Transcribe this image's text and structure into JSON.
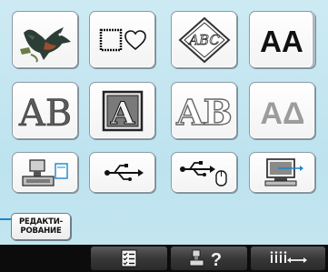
{
  "edit_button": {
    "line1": "РЕДАКТИ-",
    "line2": "РОВАНИЕ"
  },
  "grid": [
    {
      "name": "pattern-embroidery-icon"
    },
    {
      "name": "frame-shapes-icon"
    },
    {
      "name": "monogram-abc-icon",
      "text": "ABC"
    },
    {
      "name": "alphabet-font-icon",
      "text": "AA"
    },
    {
      "name": "floral-alphabet-icon",
      "text": "AB"
    },
    {
      "name": "decorative-letter-icon",
      "text": "A"
    },
    {
      "name": "outline-alphabet-icon",
      "text": "AB"
    },
    {
      "name": "greek-alphabet-icon",
      "text": "AΔ"
    },
    {
      "name": "machine-memory-icon"
    },
    {
      "name": "usb-icon"
    },
    {
      "name": "usb-mouse-icon"
    },
    {
      "name": "computer-link-icon"
    }
  ],
  "bottom_bar": {
    "items": [
      "settings-list-icon",
      "help-icon",
      "thread-length-icon"
    ],
    "help_text": "?"
  },
  "colors": {
    "background": "#bfe2ee",
    "tile": "#ffffff",
    "tile_border": "#8d9aa2",
    "accent_blue": "#1e84c8",
    "bar": "#0c0c0c"
  }
}
